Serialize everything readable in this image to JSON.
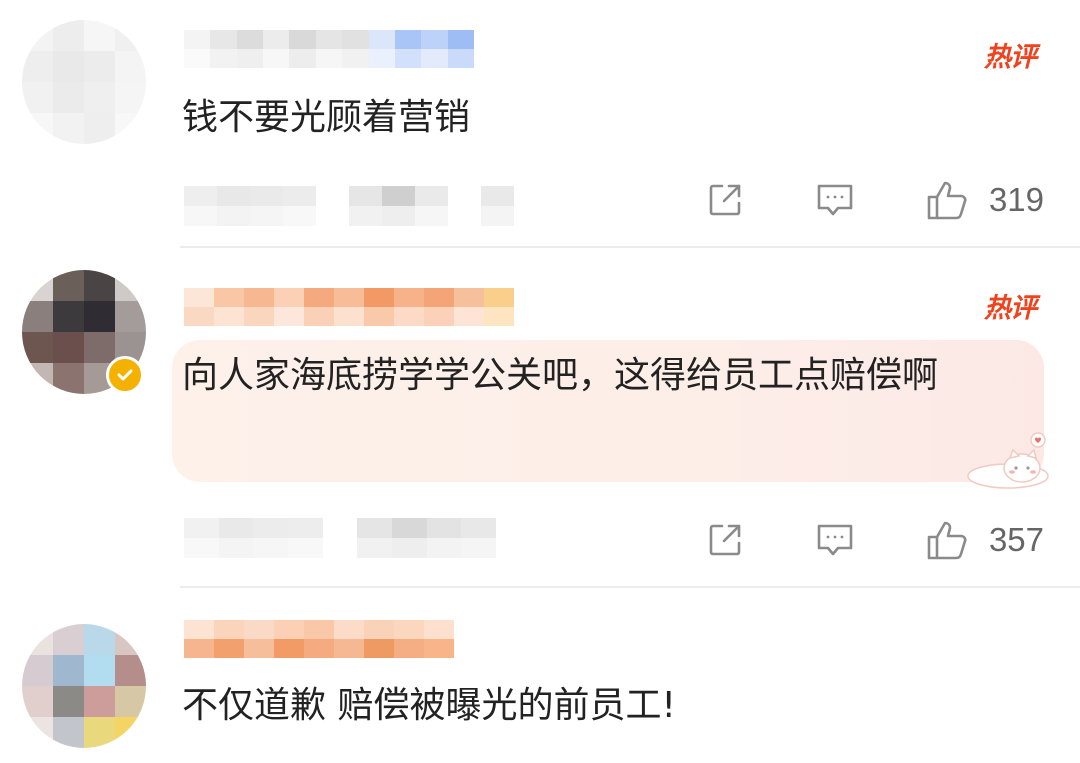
{
  "comments": [
    {
      "text": "钱不要光顾着营销",
      "badge": "热评",
      "likes": "319",
      "icons": [
        "share-icon",
        "reply-icon",
        "thumbs-up-icon"
      ],
      "highlighted": false,
      "verified": false
    },
    {
      "text": "向人家海底捞学学公关吧，这得给员工点赔偿啊",
      "badge": "热评",
      "likes": "357",
      "icons": [
        "share-icon",
        "reply-icon",
        "thumbs-up-icon"
      ],
      "highlighted": true,
      "verified": true
    },
    {
      "text": "不仅道歉 赔偿被曝光的前员工!",
      "badge": "",
      "likes": "",
      "highlighted": false,
      "verified": false
    }
  ],
  "colors": {
    "hot_badge": "#f0431d",
    "verified_badge": "#f5b100",
    "highlight_card": "#fdf0ea",
    "action_icon": "#8a8a8a",
    "divider": "#ececec"
  }
}
